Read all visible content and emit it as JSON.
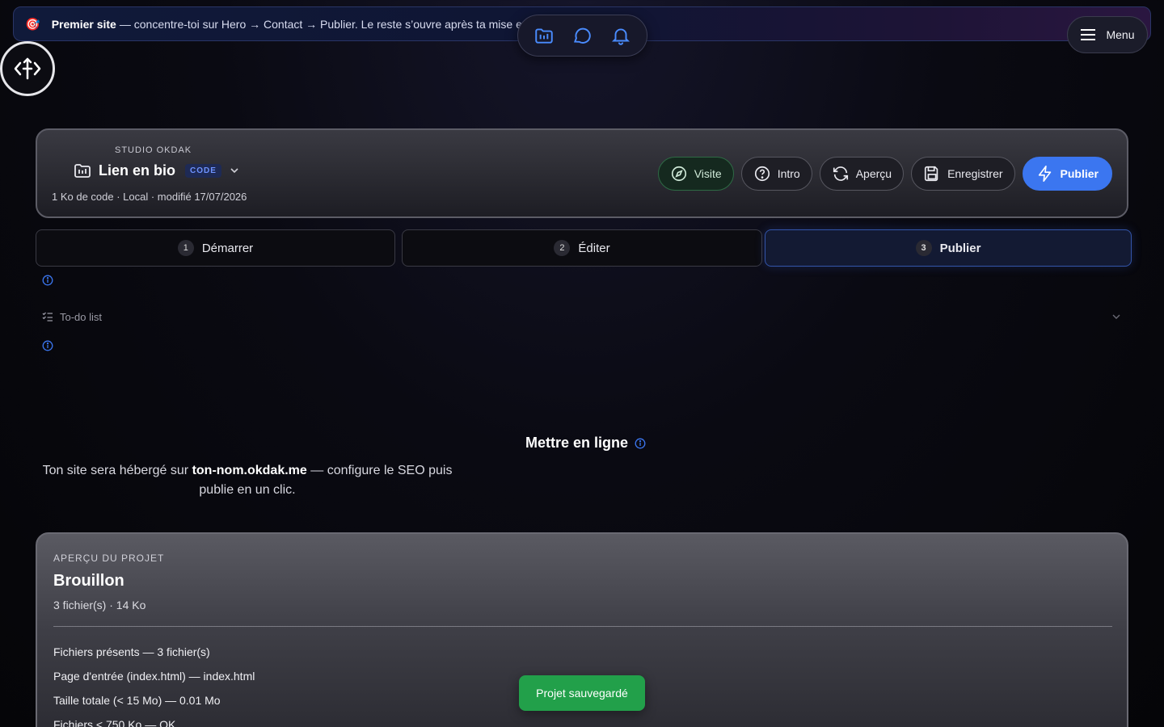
{
  "banner": {
    "emoji": "🎯",
    "title": "Premier site",
    "text": "— concentre-toi sur Hero → Contact → Publier. Le reste s’ouvre après ta mise en ligne."
  },
  "menu": {
    "label": "Menu"
  },
  "project": {
    "studio": "STUDIO OKDAK",
    "name": "Lien en bio",
    "badge": "CODE",
    "meta": "1 Ko de code · Local · modifié 17/07/2026",
    "actions": {
      "visit": "Visite",
      "intro": "Intro",
      "preview": "Aperçu",
      "save": "Enregistrer",
      "publish": "Publier"
    }
  },
  "steps": [
    {
      "num": "1",
      "label": "Démarrer"
    },
    {
      "num": "2",
      "label": "Éditer"
    },
    {
      "num": "3",
      "label": "Publier"
    }
  ],
  "todo": {
    "label": "To-do list"
  },
  "publish_section": {
    "title": "Mettre en ligne",
    "desc_before": "Ton site sera hébergé sur ",
    "desc_domain": "ton-nom.okdak.me",
    "desc_after": " — configure le SEO puis publie en un clic."
  },
  "overview": {
    "label": "APERÇU DU PROJET",
    "title": "Brouillon",
    "meta": "3 fichier(s) · 14 Ko",
    "items": [
      "Fichiers présents — 3 fichier(s)",
      "Page d'entrée (index.html) — index.html",
      "Taille totale (< 15 Mo) — 0.01 Mo",
      "Fichiers < 750 Ko — OK"
    ]
  },
  "toast": {
    "text": "Projet sauvegardé"
  },
  "colors": {
    "accent": "#3b76f0",
    "success": "#22a04a",
    "info": "#3b76f0"
  }
}
